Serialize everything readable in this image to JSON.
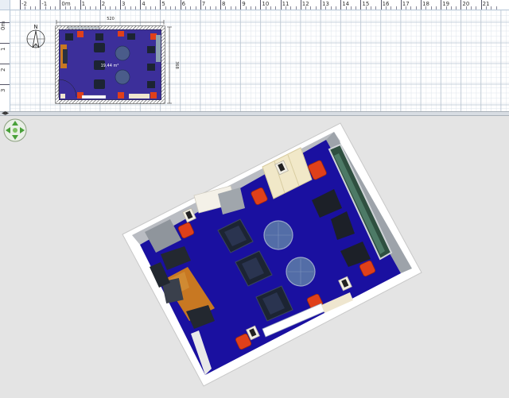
{
  "ruler": {
    "h_labels": [
      {
        "text": "-2"
      },
      {
        "text": "-1"
      },
      {
        "text": "0m"
      },
      {
        "text": "1"
      },
      {
        "text": "2"
      },
      {
        "text": "3"
      },
      {
        "text": "4"
      },
      {
        "text": "5"
      },
      {
        "text": "6"
      },
      {
        "text": "7"
      },
      {
        "text": "8"
      },
      {
        "text": "9"
      },
      {
        "text": "10"
      },
      {
        "text": "11"
      },
      {
        "text": "12"
      },
      {
        "text": "13"
      },
      {
        "text": "14"
      },
      {
        "text": "15"
      },
      {
        "text": "16"
      },
      {
        "text": "17"
      },
      {
        "text": "18"
      },
      {
        "text": "19"
      },
      {
        "text": "20"
      },
      {
        "text": "21"
      }
    ],
    "v_labels": [
      {
        "text": "0m"
      },
      {
        "text": "1"
      },
      {
        "text": "2"
      },
      {
        "text": "3"
      }
    ]
  },
  "plan": {
    "compass_label": "N",
    "width_dimension": "520",
    "height_dimension": "368",
    "room_area": "19,44 m²"
  },
  "colors": {
    "floor": "#1a10a0",
    "plan_floor": "#3c2f9a",
    "wall_top": "#ffffff",
    "chair_orange": "#e0401a",
    "armchair": "#1c2433",
    "table_glass": "#5a78a8",
    "background_3d": "#e4e4e4"
  },
  "icons": {
    "compass": "compass-icon",
    "navigation": "navigation-arrows-icon"
  }
}
